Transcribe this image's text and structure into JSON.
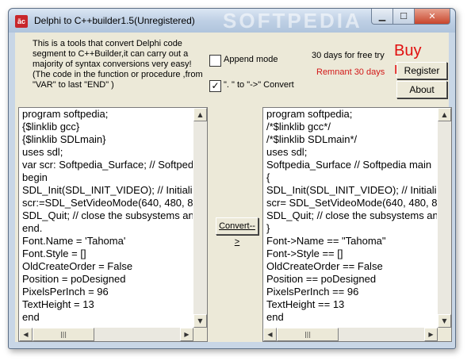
{
  "window": {
    "title": "Delphi to C++builder1.5(Unregistered)",
    "icon_text": "ãc",
    "watermark": "SOFTPEDIA"
  },
  "description": "This is a tools that convert Delphi code segment to C++Builder,it can carry out a majority of syntax conversions very easy! (The code in the function or procedure ,from \"VAR\" to last \"END\" )",
  "options": {
    "append_mode": {
      "label": "Append mode",
      "checked": false
    },
    "convert_dot": {
      "label": "\". \" to \"->\" Convert",
      "checked": true
    }
  },
  "trial": {
    "days_free": "30 days for free try",
    "remnant": "Remnant  30 days"
  },
  "buttons": {
    "buy_now": "Buy now!",
    "register": "Register",
    "about": "About",
    "convert": "Convert-->"
  },
  "editor_left": {
    "lines": [
      "program softpedia;",
      "{$linklib gcc}",
      "{$linklib SDLmain}",
      "uses sdl;",
      "var scr: Softpedia_Surface; // Softpedia main",
      "begin",
      " SDL_Init(SDL_INIT_VIDEO); // Initialize",
      " scr:=SDL_SetVideoMode(640, 480, 8, 0);",
      " SDL_Quit; // close the subsystems and SDL",
      "end.",
      "  Font.Name = 'Tahoma'",
      "  Font.Style = []",
      "  OldCreateOrder = False",
      "  Position = poDesigned",
      "  PixelsPerInch = 96",
      "  TextHeight = 13",
      "end"
    ]
  },
  "editor_right": {
    "lines": [
      "program softpedia;",
      "/*$linklib gcc*/",
      "/*$linklib SDLmain*/",
      "uses sdl;",
      " Softpedia_Surface // Softpedia main",
      "{",
      " SDL_Init(SDL_INIT_VIDEO); // Initialize",
      " scr= SDL_SetVideoMode(640, 480, 8, 0);",
      " SDL_Quit; // close the subsystems and SDL",
      "}",
      "  Font->Name == \"Tahoma\"",
      "  Font->Style == []",
      "  OldCreateOrder == False",
      "  Position == poDesigned",
      "  PixelsPerInch == 96",
      "  TextHeight == 13",
      "end"
    ]
  },
  "scroll": {
    "up": "▲",
    "down": "▼",
    "left": "◀",
    "right": "▶",
    "grip": "|||"
  },
  "colors": {
    "buy_now": "#e10f0f",
    "remnant": "#d21818",
    "window_frame": "#c8d6e6",
    "client_bg": "#ece9d8"
  }
}
